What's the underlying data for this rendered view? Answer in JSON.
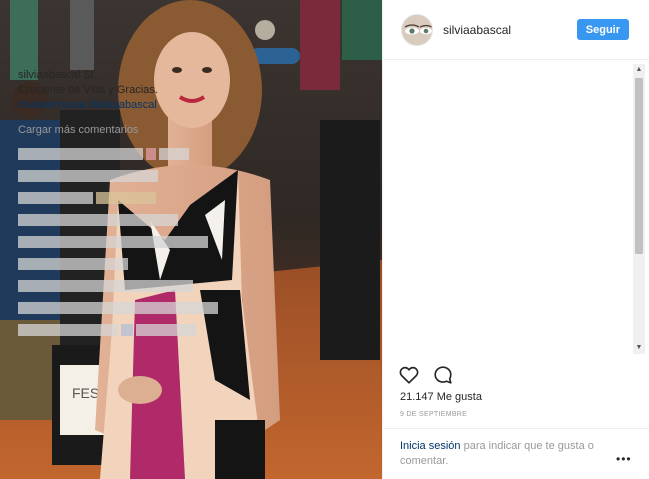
{
  "post": {
    "username": "silviaabascal",
    "follow_label": "Seguir"
  },
  "caption": {
    "username": "silviaabascal",
    "text_first": "Sí..",
    "text_second": "Creciente de Vida y Gracias.",
    "hashtags": [
      "#xabiermurua",
      "#silviaabascal"
    ]
  },
  "comments": {
    "load_more": "Cargar más comentarios"
  },
  "stats": {
    "likes": "21.147 Me gusta",
    "date": "9 DE SEPTIEMBRE"
  },
  "login_prompt": {
    "link": "Inicia sesión",
    "rest": "para indicar que te gusta o comentar."
  },
  "icons": {
    "like": "heart-icon",
    "comment": "comment-icon",
    "more": "more-options-icon"
  },
  "colors": {
    "accent": "#3897f0",
    "link": "#003569",
    "muted": "#999999"
  }
}
